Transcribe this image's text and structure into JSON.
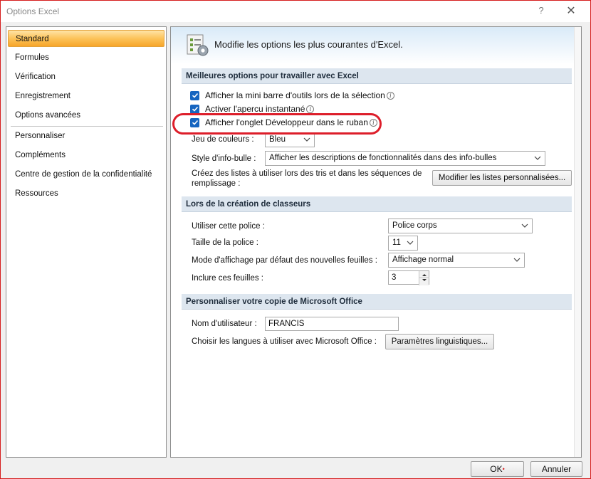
{
  "window": {
    "title": "Options Excel",
    "help_label": "?",
    "close_label": "✕"
  },
  "nav": {
    "items": [
      {
        "label": "Standard",
        "selected": true
      },
      {
        "label": "Formules"
      },
      {
        "label": "Vérification"
      },
      {
        "label": "Enregistrement"
      },
      {
        "label": "Options avancées"
      },
      {
        "label": "Personnaliser"
      },
      {
        "label": "Compléments"
      },
      {
        "label": "Centre de gestion de la confidentialité"
      },
      {
        "label": "Ressources"
      }
    ]
  },
  "banner": {
    "text": "Modifie les options les plus courantes d'Excel.",
    "icon": "options-gear-icon"
  },
  "section1": {
    "title": "Meilleures options pour travailler avec Excel",
    "checkboxes": [
      {
        "label": "Afficher la mini barre d'outils lors de la sélection",
        "checked": true
      },
      {
        "label": "Activer l'apercu instantané",
        "checked": true
      },
      {
        "label": "Afficher l'onglet Développeur dans le ruban",
        "checked": true
      }
    ],
    "color_scheme_label": "Jeu de couleurs :",
    "color_scheme_value": "Bleu",
    "tooltip_style_label": "Style d'info-bulle :",
    "tooltip_style_value": "Afficher les descriptions de fonctionnalités dans des info-bulles",
    "custom_lists_label_line1": "Créez des listes à utiliser lors des tris et dans les séquences de",
    "custom_lists_label_line2": "remplissage :",
    "custom_lists_button": "Modifier les listes personnalisées..."
  },
  "section2": {
    "title": "Lors de la création de classeurs",
    "font_label": "Utiliser cette police :",
    "font_value": "Police corps",
    "size_label": "Taille de la police :",
    "size_value": "11",
    "view_label": "Mode d'affichage par défaut des nouvelles feuilles :",
    "view_value": "Affichage normal",
    "sheets_label": "Inclure ces feuilles :",
    "sheets_value": "3"
  },
  "section3": {
    "title": "Personnaliser votre copie de Microsoft Office",
    "username_label": "Nom d'utilisateur :",
    "username_value": "FRANCIS",
    "languages_label": "Choisir les langues à utiliser avec Microsoft Office :",
    "languages_button": "Paramètres linguistiques..."
  },
  "footer": {
    "ok_label": "OK",
    "cancel_label": "Annuler"
  },
  "colors": {
    "accent_selected": "#f7a52a",
    "checkbox": "#1665c0",
    "highlight_circle": "#dd1e2a",
    "section_bg": "#dde6ef"
  }
}
